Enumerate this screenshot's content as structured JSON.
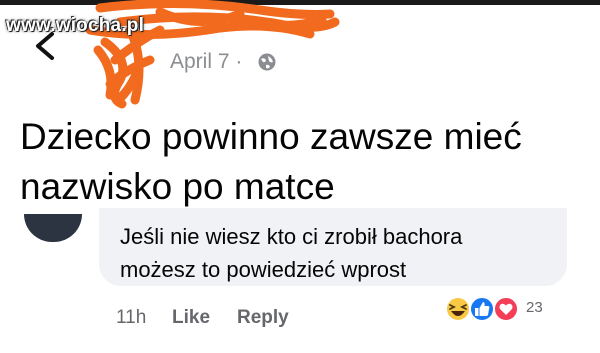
{
  "watermark": "www.wiocha.pl",
  "post": {
    "date": "April 7 ·",
    "text_line1": "Dziecko powinno zawsze mieć",
    "text_line2": "nazwisko po matce"
  },
  "comment": {
    "line1": "Jeśli nie wiesz kto ci zrobił bachora",
    "line2": "możesz to powiedzieć wprost",
    "time": "11h",
    "like_label": "Like",
    "reply_label": "Reply",
    "reaction_count": "23",
    "reaction_icons": [
      "haha-icon",
      "like-icon",
      "love-icon"
    ]
  },
  "colors": {
    "scribble": "#f26a1e",
    "bubble": "#f0f2f5",
    "meta_text": "#65676b",
    "like_blue": "#1877f2",
    "love_red": "#f33e58",
    "haha_yellow": "#f7c945"
  }
}
